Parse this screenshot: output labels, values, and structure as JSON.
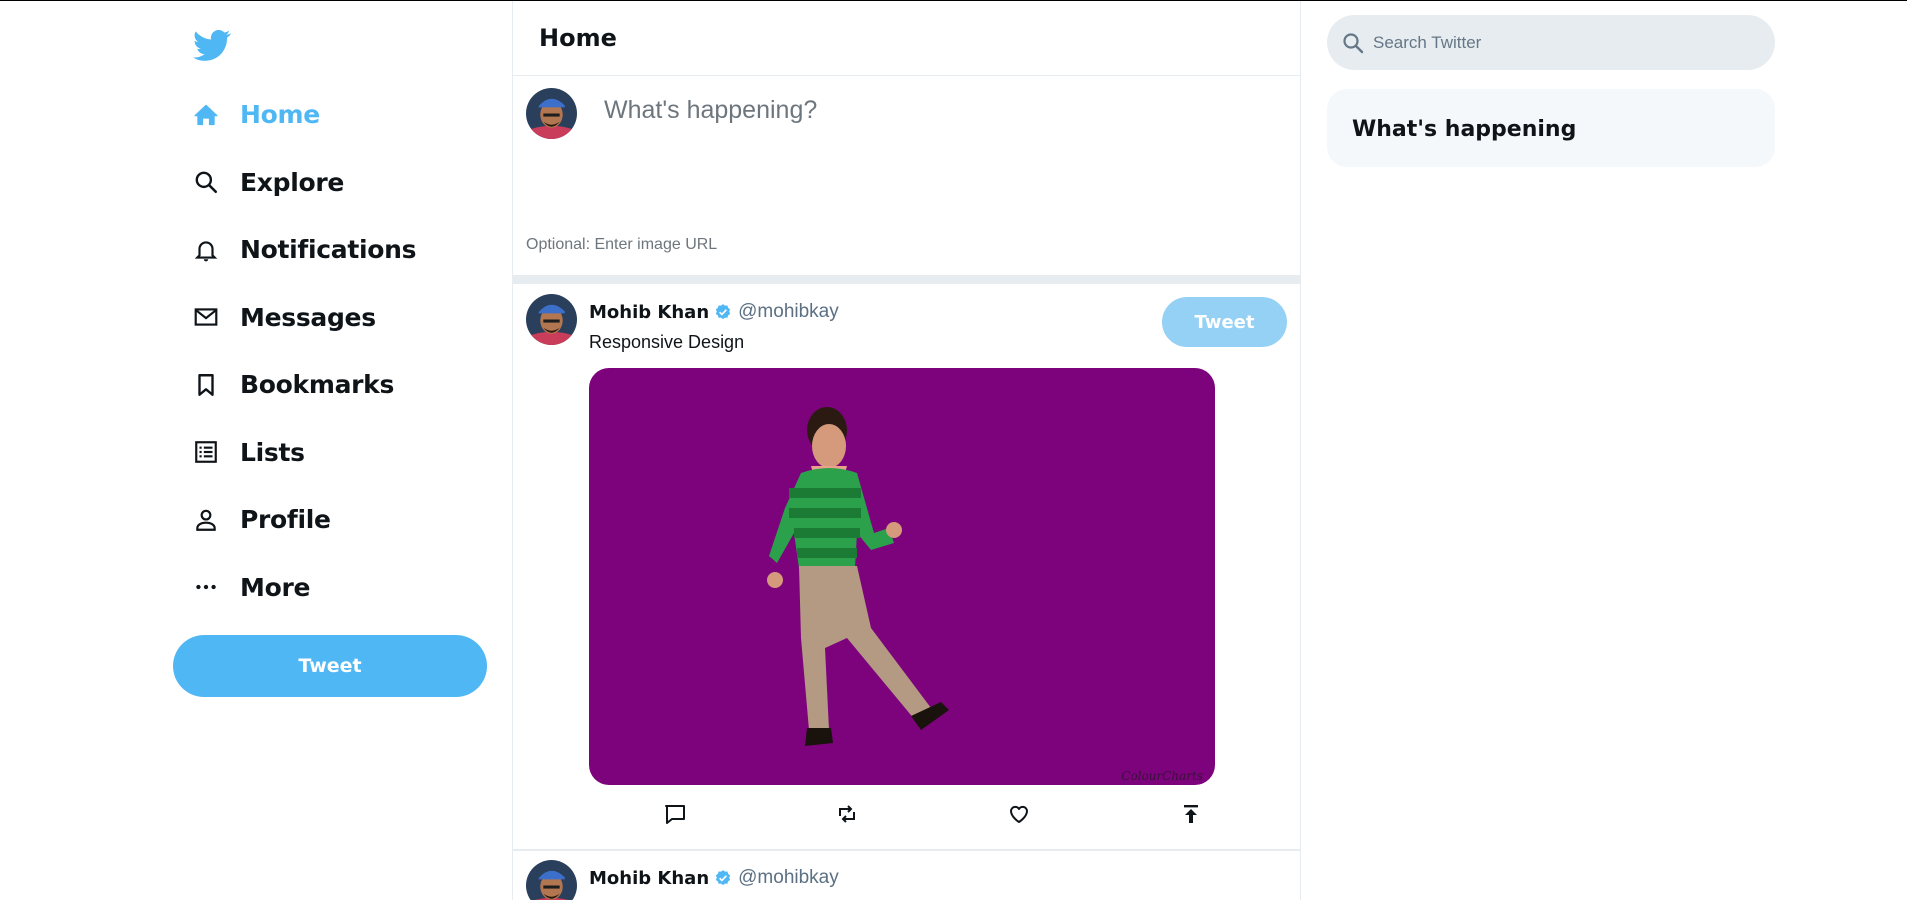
{
  "colors": {
    "accent": "#50b7f5",
    "tweetbox_button": "#95d0f5",
    "media_bg": "#7d037d",
    "border": "#e6ecf0",
    "handle": "#5b7083"
  },
  "sidebar": {
    "logo_icon": "twitter-bird-icon",
    "items": [
      {
        "label": "Home",
        "icon": "home-icon",
        "active": true
      },
      {
        "label": "Explore",
        "icon": "search-icon"
      },
      {
        "label": "Notifications",
        "icon": "bell-icon"
      },
      {
        "label": "Messages",
        "icon": "mail-icon"
      },
      {
        "label": "Bookmarks",
        "icon": "bookmark-icon"
      },
      {
        "label": "Lists",
        "icon": "list-icon"
      },
      {
        "label": "Profile",
        "icon": "person-icon"
      },
      {
        "label": "More",
        "icon": "more-icon"
      }
    ],
    "tweet_button": "Tweet"
  },
  "feed": {
    "title": "Home",
    "tweetbox": {
      "placeholder": "What's happening?",
      "image_placeholder": "Optional: Enter image URL",
      "button": "Tweet"
    },
    "posts": [
      {
        "display_name": "Mohib Khan",
        "handle": "@mohibkay",
        "verified": true,
        "text": "Responsive Design",
        "media_credit": "ColourCharts",
        "actions": [
          "reply-icon",
          "retweet-icon",
          "like-icon",
          "share-icon"
        ]
      },
      {
        "display_name": "Mohib Khan",
        "handle": "@mohibkay",
        "verified": true
      }
    ]
  },
  "widgets": {
    "search_placeholder": "Search Twitter",
    "happening_title": "What's happening"
  }
}
